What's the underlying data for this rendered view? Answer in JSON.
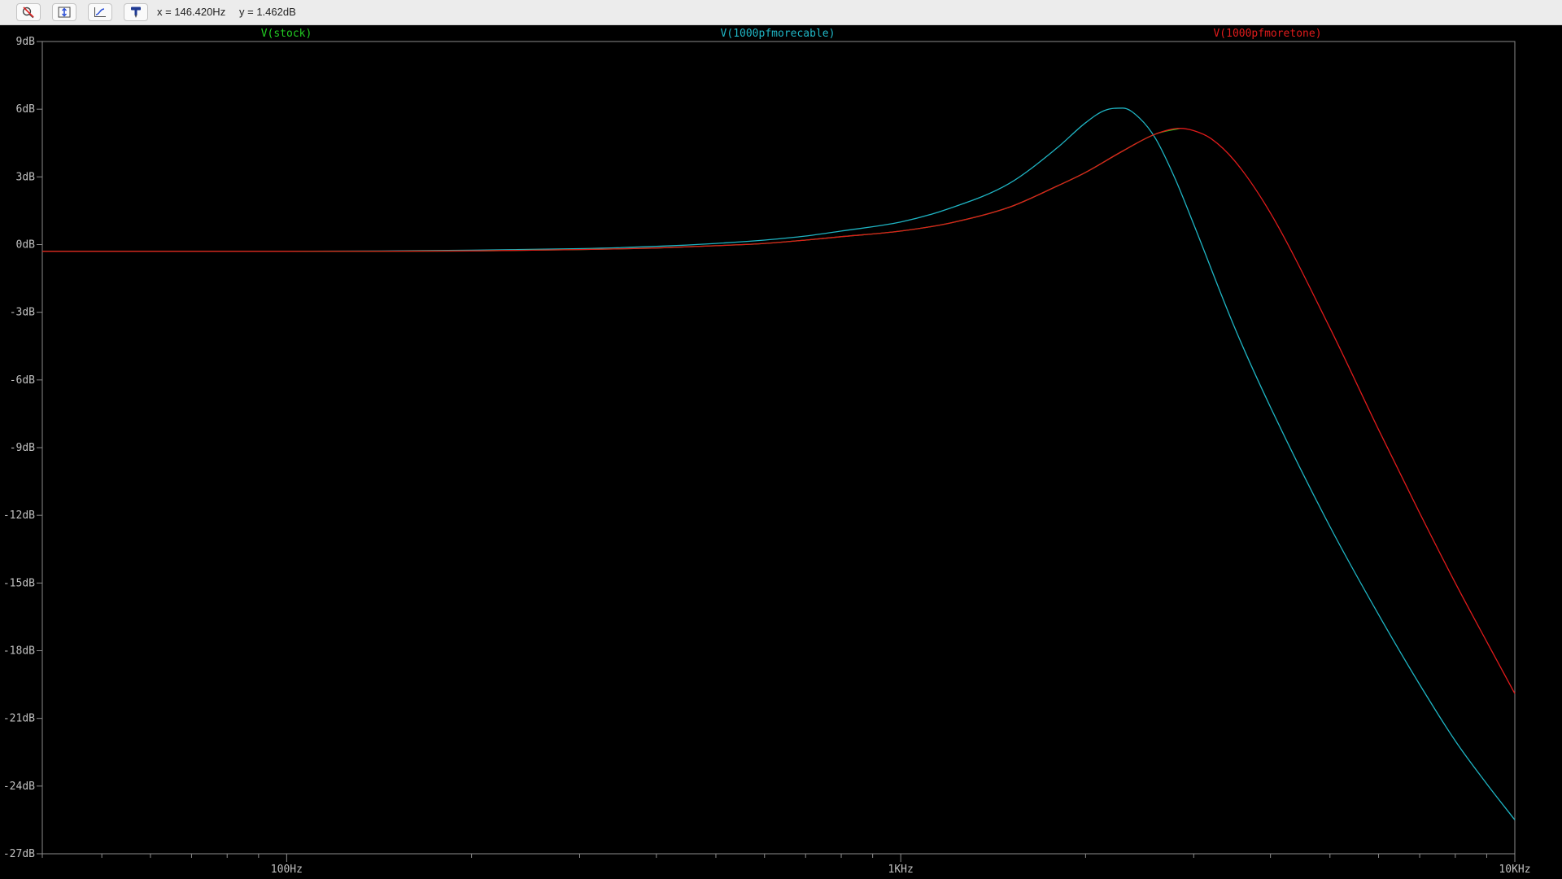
{
  "toolbar": {
    "buttons": [
      {
        "name": "zoom-cancel-button",
        "icon": "zoom-cancel-icon"
      },
      {
        "name": "autorange-y-button",
        "icon": "autorange-y-icon"
      },
      {
        "name": "autorange-x-button",
        "icon": "autorange-x-icon"
      },
      {
        "name": "cursor-probe-button",
        "icon": "probe-icon"
      }
    ],
    "x_readout": "x = 146.420Hz",
    "y_readout": "y = 1.462dB"
  },
  "colors": {
    "background": "#000000",
    "axis": "#8c8c8c",
    "tick_label": "#c0c0c0",
    "stock": "#22cc22",
    "cable": "#1fb5c4",
    "tone": "#e01b1b"
  },
  "chart_data": {
    "type": "line",
    "xscale": "log",
    "xlim": [
      40,
      10000
    ],
    "ylim": [
      -27,
      9
    ],
    "x_ticks": [
      {
        "value": 100,
        "label": "100Hz"
      },
      {
        "value": 1000,
        "label": "1KHz"
      },
      {
        "value": 10000,
        "label": "10KHz"
      }
    ],
    "y_ticks": [
      {
        "value": 9,
        "label": "9dB"
      },
      {
        "value": 6,
        "label": "6dB"
      },
      {
        "value": 3,
        "label": "3dB"
      },
      {
        "value": 0,
        "label": "0dB"
      },
      {
        "value": -3,
        "label": "-3dB"
      },
      {
        "value": -6,
        "label": "-6dB"
      },
      {
        "value": -9,
        "label": "-9dB"
      },
      {
        "value": -12,
        "label": "-12dB"
      },
      {
        "value": -15,
        "label": "-15dB"
      },
      {
        "value": -18,
        "label": "-18dB"
      },
      {
        "value": -21,
        "label": "-21dB"
      },
      {
        "value": -24,
        "label": "-24dB"
      },
      {
        "value": -27,
        "label": "-27dB"
      }
    ],
    "grid": false,
    "legend": "top",
    "series": [
      {
        "name": "V(stock)",
        "color": "#22cc22",
        "x": [
          40,
          100,
          200,
          300,
          400,
          500,
          600,
          700,
          800,
          1000,
          1200,
          1500,
          1800,
          2000,
          2300,
          2600,
          2850
        ],
        "y": [
          -0.3,
          -0.3,
          -0.28,
          -0.22,
          -0.15,
          -0.05,
          0.05,
          0.2,
          0.35,
          0.6,
          0.95,
          1.65,
          2.6,
          3.2,
          4.15,
          4.9,
          5.15
        ]
      },
      {
        "name": "V(1000pfmorecable)",
        "color": "#1fb5c4",
        "x": [
          40,
          100,
          200,
          300,
          400,
          500,
          600,
          700,
          800,
          1000,
          1200,
          1500,
          1800,
          2000,
          2150,
          2300,
          2450,
          2600,
          2800,
          3000,
          3500,
          4000,
          5000,
          6000,
          7000,
          8000,
          9000,
          10000
        ],
        "y": [
          -0.3,
          -0.3,
          -0.25,
          -0.18,
          -0.08,
          0.05,
          0.2,
          0.38,
          0.6,
          1.0,
          1.6,
          2.7,
          4.3,
          5.4,
          5.95,
          6.05,
          5.6,
          4.7,
          2.9,
          0.9,
          -3.7,
          -7.2,
          -12.5,
          -16.4,
          -19.5,
          -22.0,
          -23.9,
          -25.5
        ]
      },
      {
        "name": "V(1000pfmoretone)",
        "color": "#e01b1b",
        "x": [
          40,
          100,
          200,
          300,
          400,
          500,
          600,
          700,
          800,
          1000,
          1200,
          1500,
          1800,
          2000,
          2300,
          2600,
          2850,
          3000,
          3200,
          3500,
          4000,
          5000,
          6000,
          7000,
          8000,
          9000,
          10000
        ],
        "y": [
          -0.3,
          -0.3,
          -0.28,
          -0.22,
          -0.15,
          -0.05,
          0.05,
          0.2,
          0.35,
          0.6,
          0.95,
          1.65,
          2.6,
          3.2,
          4.15,
          4.9,
          5.15,
          5.05,
          4.7,
          3.7,
          1.4,
          -3.7,
          -8.2,
          -11.9,
          -15.0,
          -17.6,
          -19.9
        ]
      }
    ]
  }
}
